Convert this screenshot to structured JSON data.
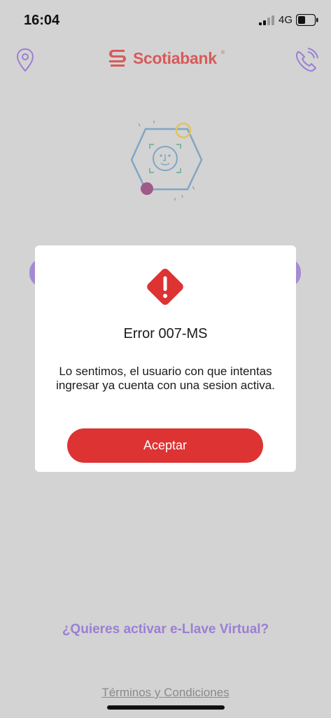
{
  "status_bar": {
    "time": "16:04",
    "network": "4G"
  },
  "header": {
    "logo_text": "Scotiabank",
    "logo_reg": "®",
    "location_icon": "location-pin-icon",
    "phone_icon": "phone-icon"
  },
  "illustration": {
    "icon": "face-id-hexagon-icon"
  },
  "dialog": {
    "icon": "warning-diamond-icon",
    "title": "Error 007-MS",
    "message": "Lo sentimos, el usuario con que intentas ingresar ya cuenta con una sesion activa.",
    "accept_label": "Aceptar"
  },
  "footer": {
    "evirtual_label": "¿Quieres activar e-Llave Virtual?",
    "terms_label": "Términos y Condiciones"
  },
  "colors": {
    "brand_red": "#dd3333",
    "accent_purple": "#9b7fd4",
    "overlay_gray": "#d3d3d3"
  }
}
